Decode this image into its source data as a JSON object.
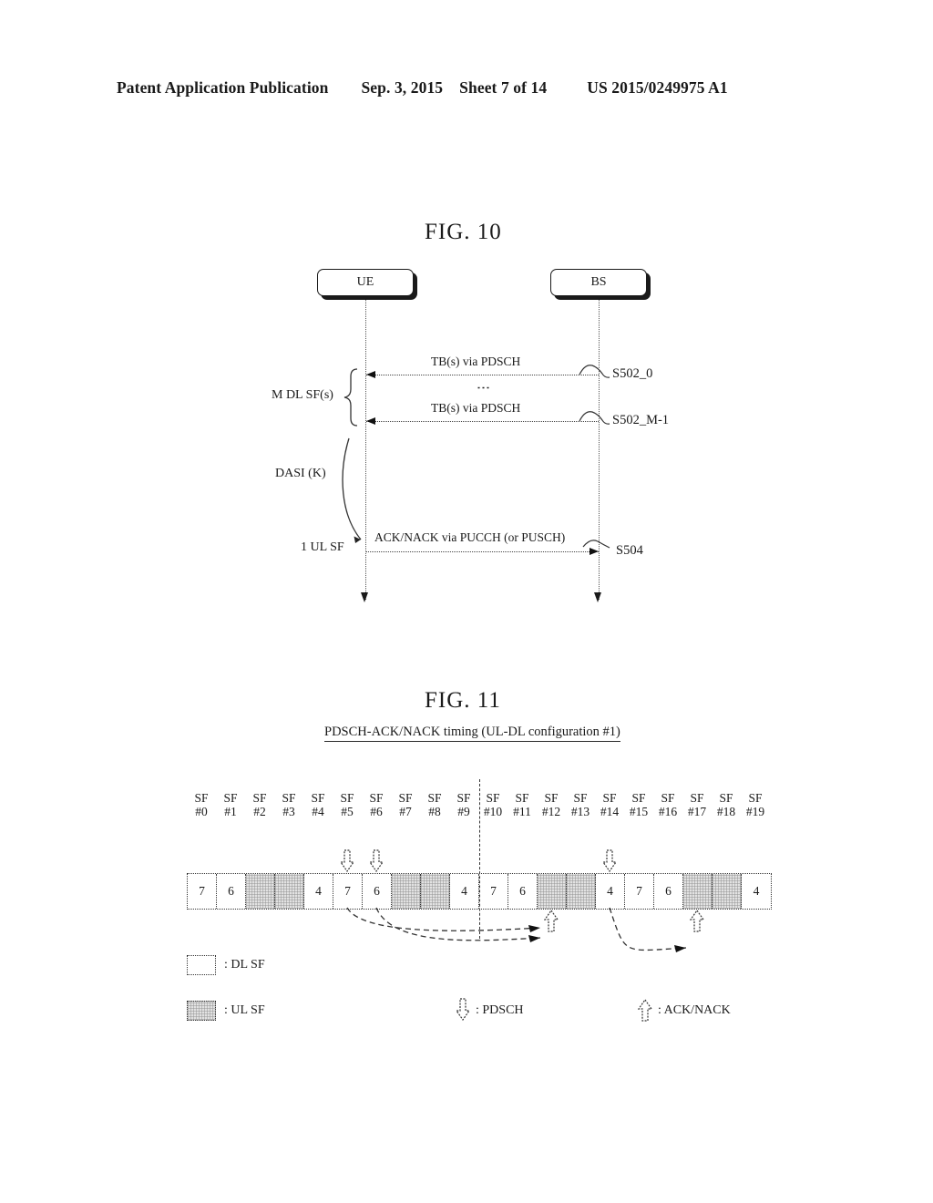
{
  "header": {
    "publication": "Patent Application Publication",
    "date": "Sep. 3, 2015",
    "sheet": "Sheet 7 of 14",
    "number": "US 2015/0249975 A1"
  },
  "fig10": {
    "title": "FIG. 10",
    "nodes": {
      "ue": "UE",
      "bs": "BS"
    },
    "messages": [
      {
        "label": "TB(s) via PDSCH",
        "step": "S502_0",
        "direction": "bs-to-ue"
      },
      {
        "label": "TB(s) via PDSCH",
        "step": "S502_M-1",
        "direction": "bs-to-ue"
      },
      {
        "label": "ACK/NACK via PUCCH (or PUSCH)",
        "step": "S504",
        "direction": "ue-to-bs"
      }
    ],
    "annotations": {
      "m_dl_sf": "M DL SF(s)",
      "dasi": "DASI (K)",
      "one_ul_sf": "1 UL SF",
      "vertical_ellipsis": "⋮"
    }
  },
  "fig11": {
    "title": "FIG. 11",
    "subtitle": "PDSCH-ACK/NACK timing (UL-DL configuration #1)",
    "sf_ticks": [
      "SF\n#0",
      "SF\n#1",
      "SF\n#2",
      "SF\n#3",
      "SF\n#4",
      "SF\n#5",
      "SF\n#6",
      "SF\n#7",
      "SF\n#8",
      "SF\n#9",
      "SF\n#10",
      "SF\n#11",
      "SF\n#12",
      "SF\n#13",
      "SF\n#14",
      "SF\n#15",
      "SF\n#16",
      "SF\n#17",
      "SF\n#18",
      "SF\n#19"
    ],
    "sf_top": [
      "SF",
      "SF",
      "SF",
      "SF",
      "SF",
      "SF",
      "SF",
      "SF",
      "SF",
      "SF",
      "SF",
      "SF",
      "SF",
      "SF",
      "SF",
      "SF",
      "SF",
      "SF",
      "SF",
      "SF"
    ],
    "sf_index": [
      "#0",
      "#1",
      "#2",
      "#3",
      "#4",
      "#5",
      "#6",
      "#7",
      "#8",
      "#9",
      "#10",
      "#11",
      "#12",
      "#13",
      "#14",
      "#15",
      "#16",
      "#17",
      "#18",
      "#19"
    ],
    "cells": [
      {
        "index": 0,
        "value": "7",
        "type": "DL"
      },
      {
        "index": 1,
        "value": "6",
        "type": "DL"
      },
      {
        "index": 2,
        "value": "",
        "type": "UL"
      },
      {
        "index": 3,
        "value": "",
        "type": "UL"
      },
      {
        "index": 4,
        "value": "4",
        "type": "DL"
      },
      {
        "index": 5,
        "value": "7",
        "type": "DL"
      },
      {
        "index": 6,
        "value": "6",
        "type": "DL"
      },
      {
        "index": 7,
        "value": "",
        "type": "UL"
      },
      {
        "index": 8,
        "value": "",
        "type": "UL"
      },
      {
        "index": 9,
        "value": "4",
        "type": "DL"
      },
      {
        "index": 10,
        "value": "7",
        "type": "DL"
      },
      {
        "index": 11,
        "value": "6",
        "type": "DL"
      },
      {
        "index": 12,
        "value": "",
        "type": "UL"
      },
      {
        "index": 13,
        "value": "",
        "type": "UL"
      },
      {
        "index": 14,
        "value": "4",
        "type": "DL"
      },
      {
        "index": 15,
        "value": "7",
        "type": "DL"
      },
      {
        "index": 16,
        "value": "6",
        "type": "DL"
      },
      {
        "index": 17,
        "value": "",
        "type": "UL"
      },
      {
        "index": 18,
        "value": "",
        "type": "UL"
      },
      {
        "index": 19,
        "value": "4",
        "type": "DL"
      }
    ],
    "pdsch_markers": [
      5,
      6,
      14
    ],
    "acknack_markers": [
      12,
      17
    ],
    "timing_arrows": [
      {
        "from": 5,
        "to": 12
      },
      {
        "from": 6,
        "to": 12
      },
      {
        "from": 14,
        "to": 17
      }
    ],
    "legend": [
      {
        "icon": "empty-box",
        "label": ": DL SF"
      },
      {
        "icon": "shaded-box",
        "label": ": UL SF"
      },
      {
        "icon": "down-arrow",
        "label": ": PDSCH"
      },
      {
        "icon": "up-arrow",
        "label": ": ACK/NACK"
      }
    ]
  }
}
